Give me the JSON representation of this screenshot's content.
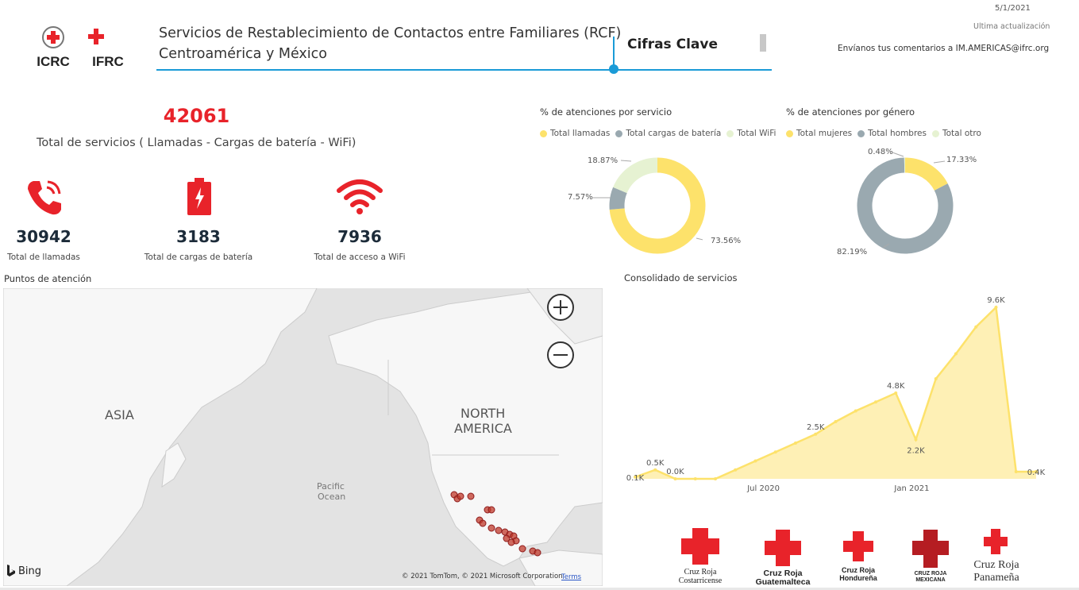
{
  "header": {
    "icrc_label": "ICRC",
    "ifrc_label": "IFRC",
    "title_line1": "Servicios de Restablecimiento de Contactos entre Familiares (RCF)",
    "title_line2": "Centroamérica y México",
    "tab_label": "Cifras Clave",
    "date": "5/1/2021",
    "update_label": "Ultima actualización",
    "feedback": "Envíanos tus comentarios a IM.AMERICAS@ifrc.org"
  },
  "totals": {
    "total_value": "42061",
    "total_label": "Total de servicios ( Llamadas - Cargas de batería - WiFi)",
    "calls_value": "30942",
    "calls_label": "Total de llamadas",
    "battery_value": "3183",
    "battery_label": "Total de cargas de batería",
    "wifi_value": "7936",
    "wifi_label": "Total de acceso a WiFi"
  },
  "colors": {
    "accent_blue": "#1a9bd7",
    "red": "#e8232a",
    "yellow": "#fde26b",
    "gray": "#9aa9b0",
    "light_green": "#e6f2d2",
    "kpi_dark": "#1c2b39"
  },
  "icons": {
    "phone": "phone-icon",
    "battery": "battery-icon",
    "wifi": "wifi-icon"
  },
  "service_donut": {
    "title": "% de atenciones por servicio",
    "legend": [
      "Total llamadas",
      "Total cargas de batería",
      "Total WiFi"
    ],
    "labels": [
      "73.56%",
      "7.57%",
      "18.87%"
    ]
  },
  "gender_donut": {
    "title": "% de atenciones por género",
    "legend": [
      "Total mujeres",
      "Total hombres",
      "Total otro"
    ],
    "labels": [
      "17.33%",
      "82.19%",
      "0.48%"
    ]
  },
  "map": {
    "title": "Puntos de atención",
    "label_asia": "ASIA",
    "label_north": "NORTH",
    "label_america": "AMERICA",
    "label_pacific": "Pacific",
    "label_ocean": "Ocean",
    "bing": "Bing",
    "copyright": "© 2021 TomTom, © 2021 Microsoft Corporation",
    "terms": "Terms"
  },
  "chart_data": {
    "type": "area",
    "title": "Consolidado de servicios",
    "x_ticks": [
      "Jul 2020",
      "Jan 2021"
    ],
    "series": [
      {
        "values": [
          0.1,
          0.5,
          0.0,
          0.0,
          0.0,
          0.5,
          1.0,
          1.5,
          2.0,
          2.5,
          3.2,
          3.8,
          4.3,
          4.8,
          2.2,
          5.6,
          7.0,
          8.5,
          9.6,
          0.4,
          0.4
        ]
      }
    ],
    "data_labels": [
      {
        "index": 0,
        "text": "0.1K"
      },
      {
        "index": 1,
        "text": "0.5K"
      },
      {
        "index": 2,
        "text": "0.0K"
      },
      {
        "index": 9,
        "text": "2.5K"
      },
      {
        "index": 13,
        "text": "4.8K"
      },
      {
        "index": 14,
        "text": "2.2K"
      },
      {
        "index": 18,
        "text": "9.6K"
      },
      {
        "index": 20,
        "text": "0.4K"
      }
    ],
    "ylim": [
      0,
      10
    ],
    "grid": false,
    "color": "#fde26b"
  },
  "footer_logos": {
    "cr1_line1": "Cruz Roja",
    "cr1_line2": "Costarricense",
    "cr2_line1": "Cruz Roja",
    "cr2_line2": "Guatemalteca",
    "cr3_line1": "Cruz Roja",
    "cr3_line2": "Hondureña",
    "cr4_line1": "CRUZ ROJA",
    "cr4_line2": "MEXICANA",
    "cr5_line1": "Cruz Roja",
    "cr5_line2": "Panameña"
  }
}
